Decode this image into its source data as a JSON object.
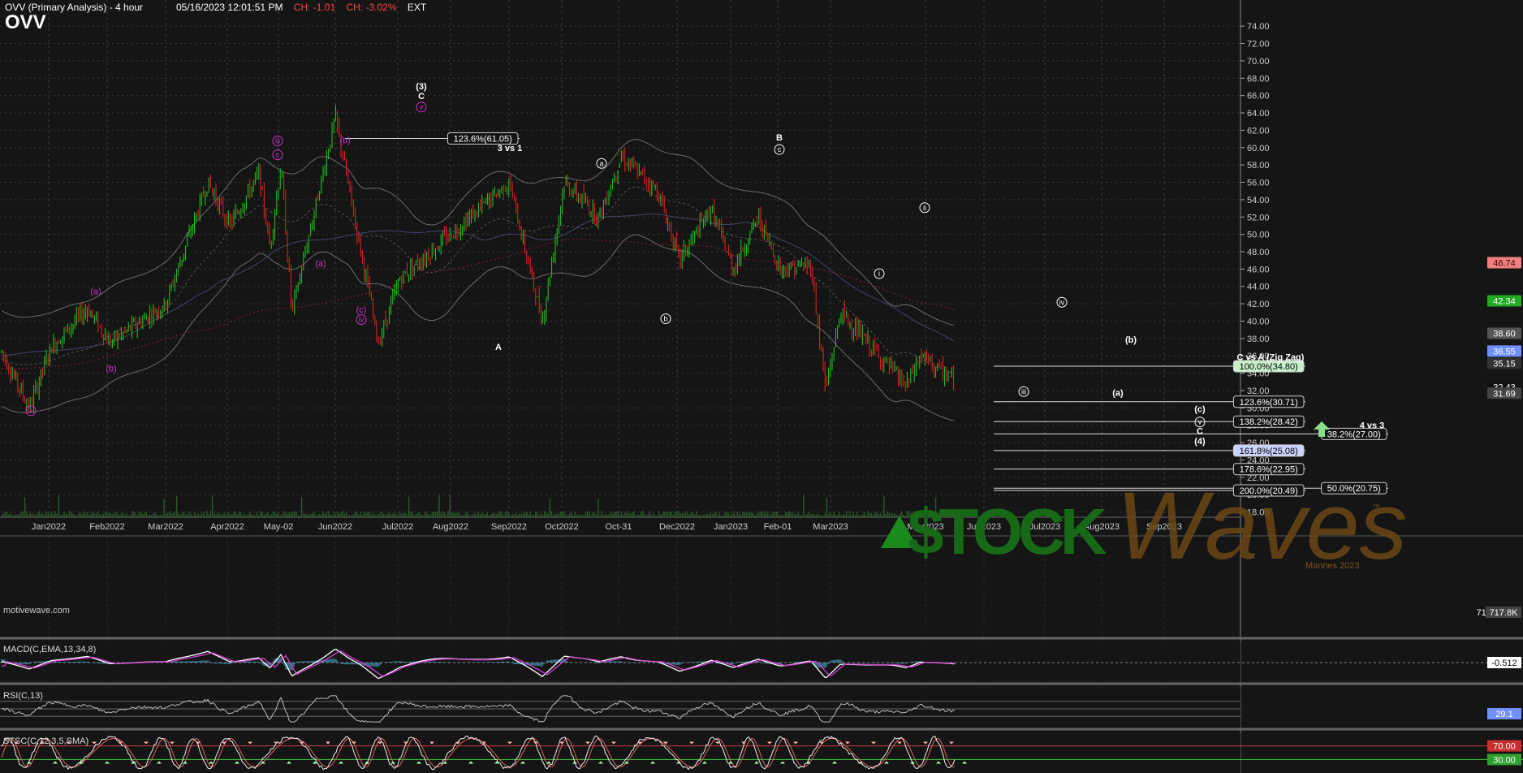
{
  "header": {
    "symbol": "OVV",
    "subtitle": "OVV (Primary Analysis) - 4 hour",
    "datetime": "05/16/2023 12:01:51 PM",
    "change": "CH: -1.01",
    "change_pct": "CH: -3.02%",
    "session": "EXT"
  },
  "watermark": "motivewave.com",
  "brand": {
    "stock": "$TOCK",
    "waves": "Waves",
    "tm": "™",
    "credit": "Mannes 2023"
  },
  "colors": {
    "up": "#22cc22",
    "down": "#ee2222",
    "accent": "#cc33cc",
    "bg": "#151515",
    "grid": "#3a3a3a"
  },
  "chart_data": {
    "type": "candlestick",
    "y_ticks": [
      "74.00",
      "72.00",
      "70.00",
      "68.00",
      "66.00",
      "64.00",
      "62.00",
      "60.00",
      "58.00",
      "56.00",
      "54.00",
      "52.00",
      "50.00",
      "48.00",
      "46.00",
      "44.00",
      "42.00",
      "40.00",
      "38.00",
      "36.00",
      "34.00",
      "32.00",
      "30.00",
      "28.00",
      "26.00",
      "24.00",
      "22.00",
      "20.00",
      "18.00"
    ],
    "ylim": [
      17.4,
      75.7
    ],
    "x_labels": [
      "Jan2022",
      "Feb2022",
      "Mar2022",
      "Apr2022",
      "May-02",
      "Jun2022",
      "Jul2022",
      "Aug2022",
      "Sep2022",
      "Oct2022",
      "Oct-31",
      "Dec2022",
      "Jan2023",
      "Feb-01",
      "Mar2023",
      "May2023",
      "Jun2023",
      "Jul2023",
      "Aug2023",
      "Sep2023"
    ],
    "price_path": [
      {
        "t": "start",
        "v": 36.5
      },
      {
        "t": "Jan2022",
        "v": 30.0
      },
      {
        "t": "Jan2022",
        "v": 37.0
      },
      {
        "t": "Feb2022",
        "v": 41.5
      },
      {
        "t": "Feb2022",
        "v": 37.5
      },
      {
        "t": "Mar2022",
        "v": 42.0
      },
      {
        "t": "Apr2022",
        "v": 56.0
      },
      {
        "t": "Apr2022",
        "v": 51.0
      },
      {
        "t": "May-02",
        "v": 57.0
      },
      {
        "t": "May-02",
        "v": 48.5
      },
      {
        "t": "May-02",
        "v": 58.0
      },
      {
        "t": "May-02",
        "v": 41.0
      },
      {
        "t": "Jun2022",
        "v": 63.5
      },
      {
        "t": "Jul2022",
        "v": 37.5
      },
      {
        "t": "Jul2022",
        "v": 45.0
      },
      {
        "t": "Aug2022",
        "v": 50.0
      },
      {
        "t": "Sep2022",
        "v": 56.0
      },
      {
        "t": "Oct2022",
        "v": 40.0
      },
      {
        "t": "Oct2022",
        "v": 56.0
      },
      {
        "t": "Oct-31",
        "v": 52.0
      },
      {
        "t": "Oct-31",
        "v": 59.0
      },
      {
        "t": "Dec2022",
        "v": 55.0
      },
      {
        "t": "Dec2022",
        "v": 47.0
      },
      {
        "t": "Jan2023",
        "v": 53.0
      },
      {
        "t": "Jan2023",
        "v": 46.0
      },
      {
        "t": "Feb-01",
        "v": 52.0
      },
      {
        "t": "Feb-01",
        "v": 46.0
      },
      {
        "t": "Mar2023",
        "v": 46.5
      },
      {
        "t": "Mar2023",
        "v": 32.0
      },
      {
        "t": "Mar2023",
        "v": 41.0
      },
      {
        "t": "May2023",
        "v": 32.5
      },
      {
        "t": "May2023",
        "v": 36.0
      },
      {
        "t": "May2023",
        "v": 33.0
      }
    ],
    "price_axis_tags": [
      {
        "text": "46.74",
        "v": 46.74,
        "color": "#f08080",
        "fg": "#400000"
      },
      {
        "text": "42.34",
        "v": 42.34,
        "color": "#22aa22",
        "fg": "#ffffff"
      },
      {
        "text": "38.60",
        "v": 38.6,
        "color": "#555555",
        "fg": "#ffffff"
      },
      {
        "text": "36.55",
        "v": 36.55,
        "color": "#7090ff",
        "fg": "#ffffff"
      },
      {
        "text": "35.15",
        "v": 35.15,
        "color": "#333333",
        "fg": "#ffffff"
      },
      {
        "text": "32.43",
        "v": 32.43,
        "color": "#111111",
        "fg": "#ffffff"
      },
      {
        "text": "31.69",
        "v": 31.69,
        "color": "#444444",
        "fg": "#ffffff"
      }
    ],
    "volume_label": "717.8K",
    "wave_labels": [
      {
        "text": "(3)",
        "x": "Jun2022",
        "v": 66.7,
        "style": "white"
      },
      {
        "text": "C",
        "x": "Jun2022",
        "v": 65.6,
        "style": "white"
      },
      {
        "text": "v",
        "x": "Jun2022",
        "v": 64.3,
        "style": "magenta-circle"
      },
      {
        "text": "iii",
        "x": "Apr2022",
        "v": 60.4,
        "style": "magenta-circle"
      },
      {
        "text": "c",
        "x": "Apr2022",
        "v": 58.8,
        "style": "magenta-circle"
      },
      {
        "text": "(b)",
        "x": "May-02",
        "v": 60.5,
        "style": "magenta"
      },
      {
        "text": "(a)",
        "x": "May-02",
        "v": 46.3,
        "style": "magenta"
      },
      {
        "text": "(c)",
        "x": "May-02",
        "v": 41.0,
        "style": "magenta"
      },
      {
        "text": "iv",
        "x": "May-02",
        "v": 39.8,
        "style": "magenta-circle"
      },
      {
        "text": "(a)",
        "x": "Feb2022",
        "v": 43.1,
        "style": "magenta"
      },
      {
        "text": "(b)",
        "x": "Feb2022",
        "v": 34.2,
        "style": "magenta"
      },
      {
        "text": "ii",
        "x": "Jan2022",
        "v": 29.3,
        "style": "magenta-circle"
      },
      {
        "text": "A",
        "x": "Jul2022",
        "v": 36.7,
        "style": "white"
      },
      {
        "text": "a",
        "x": "Sep2022",
        "v": 57.8,
        "style": "white-circle"
      },
      {
        "text": "b",
        "x": "Oct2022",
        "v": 39.9,
        "style": "white-circle"
      },
      {
        "text": "B",
        "x": "Oct-31",
        "v": 60.8,
        "style": "white"
      },
      {
        "text": "c",
        "x": "Oct-31",
        "v": 59.4,
        "style": "white-circle"
      },
      {
        "text": "i",
        "x": "Jan2023",
        "v": 45.1,
        "style": "white-circle"
      },
      {
        "text": "ii",
        "x": "Feb-01",
        "v": 52.7,
        "style": "white-circle"
      },
      {
        "text": "iii",
        "x": "Mar2023",
        "v": 31.5,
        "style": "white-circle"
      },
      {
        "text": "iv",
        "x": "Mar2023",
        "v": 41.8,
        "style": "white-circle"
      },
      {
        "text": "(b)",
        "x": "May2023",
        "v": 37.5,
        "style": "white"
      },
      {
        "text": "(a)",
        "x": "May2023",
        "v": 31.4,
        "style": "white"
      },
      {
        "text": "(c)",
        "x": "Jun2023",
        "v": 29.5,
        "style": "white"
      },
      {
        "text": "v",
        "x": "Jun2023",
        "v": 28.0,
        "style": "white-circle"
      },
      {
        "text": "C",
        "x": "Jun2023",
        "v": 27.0,
        "style": "white"
      },
      {
        "text": "(4)",
        "x": "Jun2023",
        "v": 25.8,
        "style": "white"
      }
    ],
    "fib_lines": [
      {
        "label": "123.6%(61.05)",
        "v": 61.05,
        "x0": "Jun2022",
        "x1": "Jul2022",
        "style": "white"
      },
      {
        "label": "100.0%(34.80)",
        "v": 34.8,
        "x0": "Jun2023",
        "x1": "Aug2023",
        "style": "green"
      },
      {
        "label": "123.6%(30.71)",
        "v": 30.71,
        "x0": "Jun2023",
        "x1": "Aug2023",
        "style": "white"
      },
      {
        "label": "138.2%(28.42)",
        "v": 28.42,
        "x0": "Jun2023",
        "x1": "Aug2023",
        "style": "white"
      },
      {
        "label": "38.2%(27.00)",
        "v": 27.0,
        "x0": "Jun2023",
        "x1": "Sep2023",
        "style": "white"
      },
      {
        "label": "161.8%(25.08)",
        "v": 25.08,
        "x0": "Jun2023",
        "x1": "Aug2023",
        "style": "blue"
      },
      {
        "label": "178.6%(22.95)",
        "v": 22.95,
        "x0": "Jun2023",
        "x1": "Aug2023",
        "style": "white"
      },
      {
        "label": "50.0%(20.75)",
        "v": 20.75,
        "x0": "Jun2023",
        "x1": "Sep2023",
        "style": "white"
      },
      {
        "label": "200.0%(20.49)",
        "v": 20.49,
        "x0": "Jun2023",
        "x1": "Aug2023",
        "style": "white"
      }
    ],
    "annotations": [
      {
        "text": "3 vs 1",
        "x": "Jul2022",
        "v": 60.0
      },
      {
        "text": "C vs A (Zig Zag)",
        "x": "Jul2023",
        "v": 35.9
      },
      {
        "text": "4 vs 3",
        "x": "Sep2023",
        "v": 28.0
      }
    ],
    "panels": [
      {
        "name": "MACD(C,EMA,13,34,8)",
        "value": "-0.512"
      },
      {
        "name": "RSI(C,13)",
        "value": "29.1"
      },
      {
        "name": "STSC(C,12,3,5,SMA)",
        "levels": [
          "70.00",
          "30.00"
        ]
      }
    ]
  }
}
